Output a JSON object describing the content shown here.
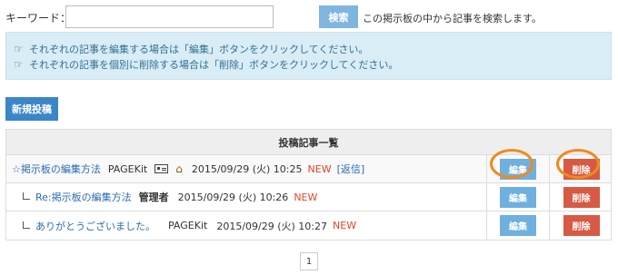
{
  "search": {
    "label": "キーワード：",
    "value": "",
    "placeholder": "",
    "button": "検索",
    "description": "この掲示板の中から記事を検索します。"
  },
  "info": {
    "lines": [
      "それぞれの記事を編集する場合は「編集」ボタンをクリックしてください。",
      "それぞれの記事を個別に削除する場合は「削除」ボタンをクリックしてください。"
    ]
  },
  "new_post_button": "新規投稿",
  "table": {
    "header": "投稿記事一覧",
    "edit_label": "編集",
    "delete_label": "削除",
    "rows": [
      {
        "title": "☆掲示板の編集方法",
        "author": "PAGEKit",
        "date": "2015/09/29 (火) 10:25",
        "new": "NEW",
        "reply": "[返信]"
      },
      {
        "title": "Re:掲示板の編集方法",
        "author": "管理者",
        "date": "2015/09/29 (火) 10:26",
        "new": "NEW"
      },
      {
        "title": "ありがとうございました。",
        "author": "PAGEKit",
        "date": "2015/09/29 (火) 10:27",
        "new": "NEW"
      }
    ]
  },
  "pagination": {
    "current": "1"
  },
  "colors": {
    "info_bg": "#d9edf7",
    "primary": "#3a86c8",
    "edit": "#6fb0df",
    "delete": "#d75a45",
    "new": "#e0452b",
    "highlight_ring": "#f08a1c"
  }
}
